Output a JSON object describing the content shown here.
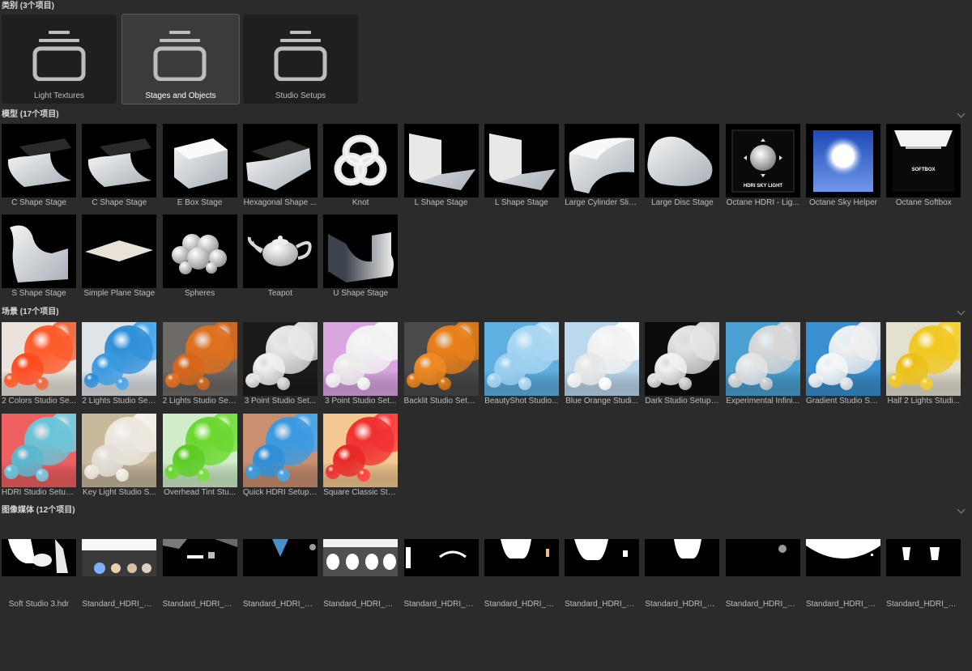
{
  "sections": {
    "categories": {
      "title": "类别 (3个项目)"
    },
    "models": {
      "title": "模型 (17个项目)"
    },
    "scenes": {
      "title": "场景 (17个项目)"
    },
    "media": {
      "title": "图像媒体 (12个项目)"
    }
  },
  "categories": [
    {
      "label": "Light Textures",
      "selected": false
    },
    {
      "label": "Stages and Objects",
      "selected": true
    },
    {
      "label": "Studio Setups",
      "selected": false
    }
  ],
  "models": [
    {
      "label": "C Shape Stage",
      "icon": "c-shape-stage-icon"
    },
    {
      "label": "C Shape Stage",
      "icon": "c-shape-stage-icon"
    },
    {
      "label": "E Box Stage",
      "icon": "box-stage-icon"
    },
    {
      "label": "Hexagonal Shape ...",
      "icon": "hexagonal-stage-icon"
    },
    {
      "label": "Knot",
      "icon": "knot-icon"
    },
    {
      "label": "L Shape Stage",
      "icon": "l-shape-stage-icon"
    },
    {
      "label": "L Shape Stage",
      "icon": "l-shape-stage-icon"
    },
    {
      "label": "Large Cylinder Slic...",
      "icon": "cylinder-slice-icon"
    },
    {
      "label": "Large Disc Stage",
      "icon": "disc-stage-icon"
    },
    {
      "label": "Octane HDRI -  Lig...",
      "icon": "hdri-sky-light-icon",
      "caption": "HDRI SKY LIGHT"
    },
    {
      "label": "Octane Sky Helper",
      "icon": "sky-helper-icon"
    },
    {
      "label": "Octane Softbox",
      "icon": "softbox-icon",
      "caption": "SOFTBOX"
    },
    {
      "label": "S Shape Stage",
      "icon": "s-shape-stage-icon"
    },
    {
      "label": "Simple Plane Stage",
      "icon": "plane-stage-icon"
    },
    {
      "label": "Spheres",
      "icon": "spheres-icon"
    },
    {
      "label": "Teapot",
      "icon": "teapot-icon"
    },
    {
      "label": "U Shape Stage",
      "icon": "u-shape-stage-icon"
    }
  ],
  "scenes": [
    {
      "label": "2 Colors Studio Se...",
      "bg": "#e9e3dc",
      "colors": [
        "#ff5a2a",
        "#ff4a20",
        "#f06a40"
      ]
    },
    {
      "label": "2 Lights Studio Set...",
      "bg": "#dfe4e8",
      "colors": [
        "#2f8fd8",
        "#3a9ae0",
        "#4aa6e8"
      ]
    },
    {
      "label": "2 Lights Studio Set...",
      "bg": "#6e6a66",
      "colors": [
        "#e0701e",
        "#d8661a",
        "#cf6a22"
      ]
    },
    {
      "label": "3 Point Studio Set...",
      "bg": "#1a1a1a",
      "colors": [
        "#e8e8e8",
        "#f0f0f0",
        "#dcdcdc"
      ]
    },
    {
      "label": "3 Point Studio Set...",
      "bg": "#d9a6e0",
      "colors": [
        "#f2f2f2",
        "#ececec",
        "#f6f6f6"
      ]
    },
    {
      "label": "Backlit Studio Setu...",
      "bg": "#4a4a4a",
      "colors": [
        "#e8801a",
        "#f08a20",
        "#d87a18"
      ]
    },
    {
      "label": "BeautyShot Studio...",
      "bg": "#5fb0e0",
      "colors": [
        "#a8d6f2",
        "#9ccff0",
        "#b4dcf4"
      ]
    },
    {
      "label": "Blue Orange Studi...",
      "bg": "#bcd8ec",
      "colors": [
        "#f2f2f2",
        "#e8e8e8",
        "#ffffff"
      ]
    },
    {
      "label": "Dark Studio Setup....",
      "bg": "#0c0c0c",
      "colors": [
        "#e4e4e4",
        "#f2f2f2",
        "#d8d8d8"
      ]
    },
    {
      "label": "Experimental Infini...",
      "bg": "#4aa0d0",
      "colors": [
        "#d8d8d8",
        "#e4e4e4",
        "#cfcfcf"
      ]
    },
    {
      "label": "Gradient Studio Se...",
      "bg": "#3a8fd0",
      "colors": [
        "#efefef",
        "#f6f6f6",
        "#e6e6e6"
      ]
    },
    {
      "label": "Half 2 Lights Studi...",
      "bg": "#e4e0d0",
      "colors": [
        "#f0c820",
        "#ecc018",
        "#f4d030"
      ]
    },
    {
      "label": "HDRI Studio Setup...",
      "bg": "#f06060",
      "colors": [
        "#6ac4d8",
        "#5ab8d0",
        "#7acce0"
      ]
    },
    {
      "label": "Key Light Studio S...",
      "bg": "#c8b89c",
      "colors": [
        "#ece8e0",
        "#e4e0d8",
        "#f4f0e8"
      ]
    },
    {
      "label": "Overhead Tint Stu...",
      "bg": "#d0ecc8",
      "colors": [
        "#6ad830",
        "#5ccc24",
        "#78e040"
      ]
    },
    {
      "label": "Quick HDRI Setup....",
      "bg": "#c89070",
      "colors": [
        "#3a9ae0",
        "#2f8fd8",
        "#4aa6e8"
      ]
    },
    {
      "label": "Square Classic Stu...",
      "bg": "#f4c890",
      "colors": [
        "#f03030",
        "#e82828",
        "#ff4040"
      ]
    }
  ],
  "media": [
    {
      "label": "Soft Studio 3.hdr"
    },
    {
      "label": "Standard_HDRI_St..."
    },
    {
      "label": "Standard_HDRI_St..."
    },
    {
      "label": "Standard_HDRI_St..."
    },
    {
      "label": "Standard_HDRI_St..."
    },
    {
      "label": "Standard_HDRI_St..."
    },
    {
      "label": "Standard_HDRI_St..."
    },
    {
      "label": "Standard_HDRI_St..."
    },
    {
      "label": "Standard_HDRI_St..."
    },
    {
      "label": "Standard_HDRI_St..."
    },
    {
      "label": "Standard_HDRI_St..."
    },
    {
      "label": "Standard_HDRI_St..."
    }
  ]
}
